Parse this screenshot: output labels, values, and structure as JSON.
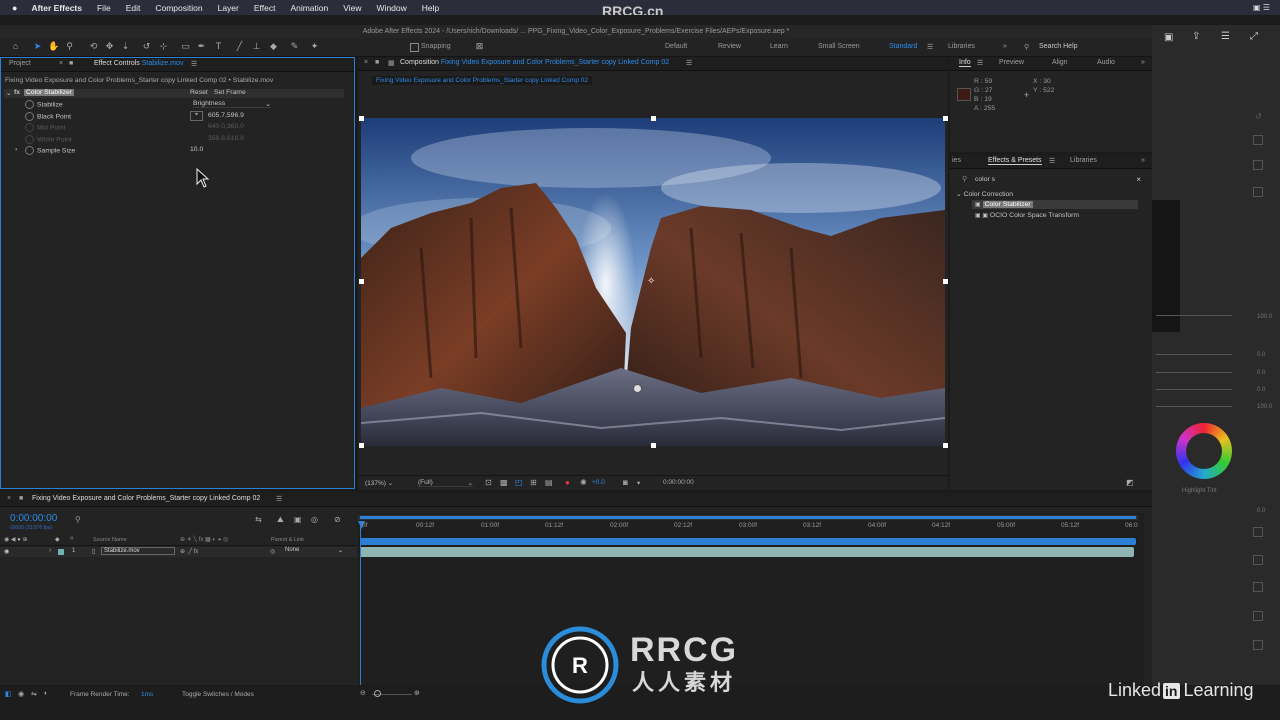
{
  "menubar": {
    "app_name": "After Effects",
    "items": [
      "File",
      "Edit",
      "Composition",
      "Layer",
      "Effect",
      "Animation",
      "View",
      "Window",
      "Help"
    ]
  },
  "watermark_top": "RRCG.cn",
  "window_title": "Adobe After Effects 2024 - /Users/rich/Downloads/ ... PPG_Fixing_Video_Color_Exposure_Problems/Exercise Files/AEPs/Exposure.aep *",
  "toolbar": {
    "snapping_label": "Snapping",
    "workspaces": [
      "Default",
      "Review",
      "Learn",
      "Small Screen",
      "Standard",
      "Libraries"
    ],
    "active_workspace": "Standard",
    "search_help": "Search Help"
  },
  "left_panel": {
    "tab_project": "Project",
    "tab_effect_controls": "Effect Controls",
    "tab_effect_controls_file": "Stabilize.mov",
    "breadcrumb": "Fixing Video Exposure and Color Problems_Starter copy Linked Comp 02 • Stabilize.mov",
    "effect_name": "Color Stabilizer",
    "reset_label": "Reset",
    "set_frame_label": "Set Frame",
    "props": [
      {
        "label": "Stabilize",
        "value": "Brightness"
      },
      {
        "label": "Black Point",
        "value": "605.7,596.9"
      },
      {
        "label": "Mid Point",
        "value": "640.0,360.0"
      },
      {
        "label": "White Point",
        "value": "359.8,618.8"
      },
      {
        "label": "Sample Size",
        "value": "10.0"
      }
    ]
  },
  "comp_panel": {
    "tab_label": "Composition",
    "tab_comp_name": "Fixing Video Exposure and Color Problems_Starter copy Linked Comp 02",
    "subtab": "Fixing Video Exposure and Color Problems_Starter copy Linked Comp 02",
    "zoom": "(137%)",
    "resolution": "(Full)",
    "exposure": "+0.0",
    "timecode": "0:00:00:00"
  },
  "info_panel": {
    "tabs": [
      "Info",
      "Preview",
      "Align",
      "Audio"
    ],
    "r": "R : 59",
    "g": "G : 27",
    "b": "B : 19",
    "a": "A : 255",
    "x": "X : 30",
    "y": "Y : 522",
    "swatch_color": "#3b1b13"
  },
  "effects_panel": {
    "tab_prefix": "ies",
    "tab_effects": "Effects & Presets",
    "tab_libraries": "Libraries",
    "search_value": "color s",
    "category": "Color Correction",
    "items": [
      "Color Stabilizer",
      "OCIO Color Space Transform"
    ]
  },
  "timeline": {
    "tab_label": "Fixing Video Exposure and Color Problems_Starter copy Linked Comp 02",
    "current_time": "0:00:00:00",
    "frame_info": "00000 (23.976 fps)",
    "col_source_name": "Source Name",
    "col_parent": "Parent & Link",
    "layer_index": "1",
    "layer_name": "Stabilize.mov",
    "parent_value": "None",
    "ruler": [
      "0f",
      "00:12f",
      "01:00f",
      "01:12f",
      "02:00f",
      "02:12f",
      "03:00f",
      "03:12f",
      "04:00f",
      "04:12f",
      "05:00f",
      "05:12f",
      "06:0"
    ],
    "frame_render_label": "Frame Render Time:",
    "frame_render_value": "1ms",
    "toggle_label": "Toggle Switches / Modes"
  },
  "right_strip": {
    "values": [
      "100.0",
      "0.0",
      "0.0",
      "0.0",
      "100.0",
      "0.0"
    ],
    "highlight_tint": "Highlight Tint"
  },
  "branding": {
    "logo_letters": "RRCG",
    "logo_sub": "人人素材",
    "linkedin_a": "Linked",
    "linkedin_in": "in",
    "linkedin_b": "Learning"
  }
}
